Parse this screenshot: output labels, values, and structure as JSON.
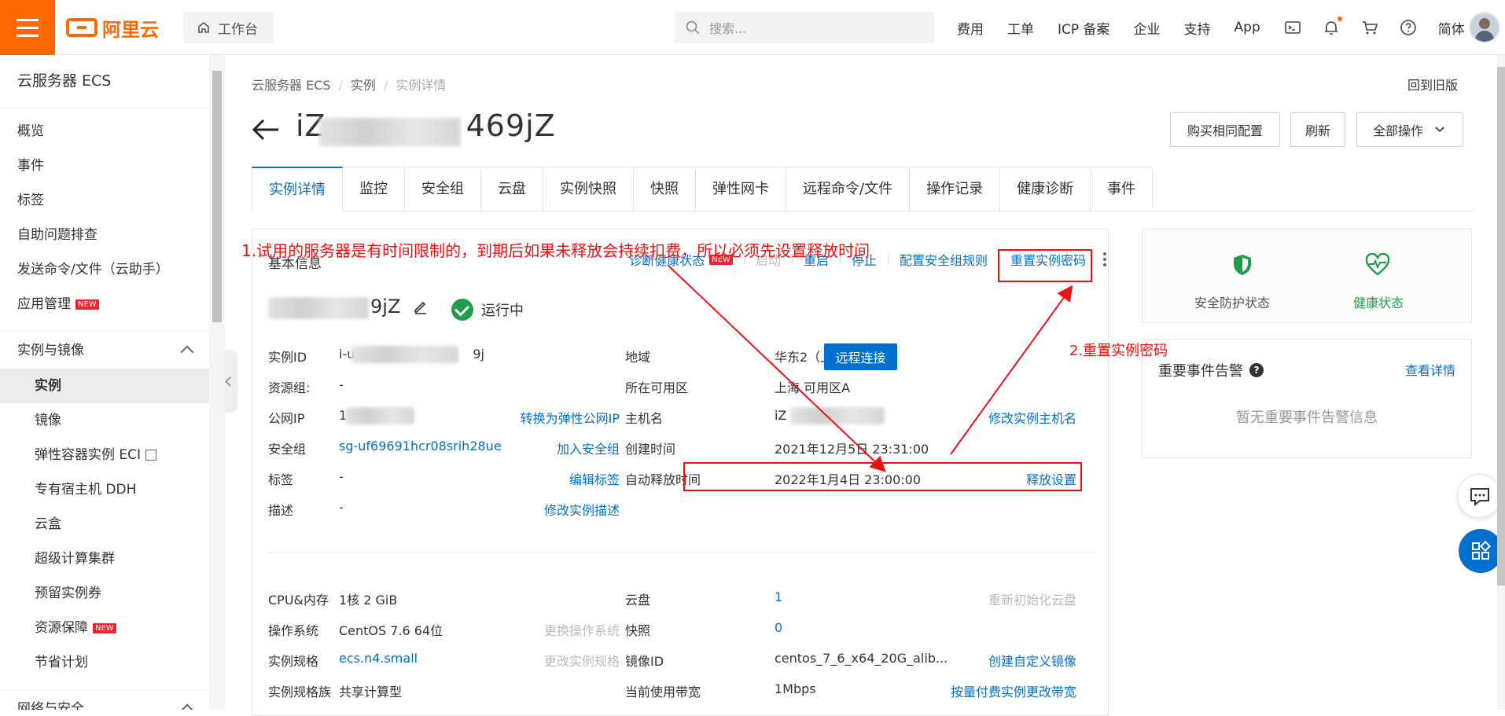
{
  "topbar": {
    "logo_text": "阿里云",
    "workbench": "工作台",
    "search_placeholder": "搜索...",
    "nav": [
      "费用",
      "工单",
      "ICP 备案",
      "企业",
      "支持",
      "App"
    ],
    "lang": "简体"
  },
  "sidebar": {
    "title": "云服务器 ECS",
    "items": [
      "概览",
      "事件",
      "标签",
      "自助问题排查",
      "发送命令/文件（云助手）",
      "应用管理"
    ],
    "new_badge": "NEW",
    "section1": "实例与镜像",
    "sub_items": [
      "实例",
      "镜像",
      "弹性容器实例 ECI",
      "专有宿主机 DDH",
      "云盒",
      "超级计算集群",
      "预留实例券",
      "资源保障",
      "节省计划"
    ],
    "section2": "网络与安全"
  },
  "breadcrumb": [
    "云服务器 ECS",
    "实例",
    "实例详情"
  ],
  "old_version": "回到旧版",
  "page_title_prefix": "iZ",
  "page_title_suffix": "469jZ",
  "buttons": {
    "buy_same": "购买相同配置",
    "refresh": "刷新",
    "all_ops": "全部操作"
  },
  "tabs": [
    "实例详情",
    "监控",
    "安全组",
    "云盘",
    "实例快照",
    "快照",
    "弹性网卡",
    "远程命令/文件",
    "操作记录",
    "健康诊断",
    "事件"
  ],
  "basic": {
    "title": "基本信息",
    "actions": {
      "diagnose": "诊断健康状态",
      "start": "启动",
      "restart": "重启",
      "stop": "停止",
      "config_sg": "配置安全组规则",
      "reset_pwd": "重置实例密码"
    },
    "name_suffix": "9jZ",
    "status": "运行中",
    "left": {
      "instance_id_label": "实例ID",
      "instance_id_prefix": "i-u",
      "instance_id_suffix": "9j",
      "remote": "远程连接",
      "resource_group_label": "资源组:",
      "resource_group": "-",
      "public_ip_label": "公网IP",
      "public_ip_prefix": "1",
      "convert_eip": "转换为弹性公网IP",
      "sg_label": "安全组",
      "sg_value": "sg-uf69691hcr08srih28ue",
      "add_sg": "加入安全组",
      "tag_label": "标签",
      "tag_value": "-",
      "edit_tag": "编辑标签",
      "desc_label": "描述",
      "desc_value": "-",
      "edit_desc": "修改实例描述"
    },
    "right": {
      "region_label": "地域",
      "region": "华东2（上海）",
      "zone_label": "所在可用区",
      "zone": "上海 可用区A",
      "host_label": "主机名",
      "host_prefix": "iZ",
      "edit_host": "修改实例主机名",
      "created_label": "创建时间",
      "created": "2021年12月5日 23:31:00",
      "release_label": "自动释放时间",
      "release": "2022年1月4日 23:00:00",
      "release_setting": "释放设置"
    }
  },
  "config": {
    "cpu_label": "CPU&内存",
    "cpu": "1核 2 GiB",
    "os_label": "操作系统",
    "os": "CentOS 7.6 64位",
    "change_os": "更换操作系统",
    "spec_label": "实例规格",
    "spec": "ecs.n4.small",
    "change_spec": "更改实例规格",
    "family_label": "实例规格族",
    "family": "共享计算型",
    "disk_label": "云盘",
    "disk": "1",
    "reinit_disk": "重新初始化云盘",
    "snapshot_label": "快照",
    "snapshot": "0",
    "image_label": "镜像ID",
    "image": "centos_7_6_x64_20G_alib...",
    "create_image": "创建自定义镜像",
    "bw_label": "当前使用带宽",
    "bw": "1Mbps",
    "change_bw": "按量付费实例更改带宽"
  },
  "right_panel": {
    "security": "安全防护状态",
    "health": "健康状态",
    "events_title": "重要事件告警",
    "events_link": "查看详情",
    "events_empty": "暂无重要事件告警信息"
  },
  "annotations": {
    "note1": "1.试用的服务器是有时间限制的，到期后如果未释放会持续扣费，所以必须先设置释放时间",
    "note2": "2.重置实例密码"
  },
  "colors": {
    "brand": "#ff6a00",
    "link": "#0070cc",
    "success": "#1e9e4a",
    "annotation": "#e11111"
  }
}
